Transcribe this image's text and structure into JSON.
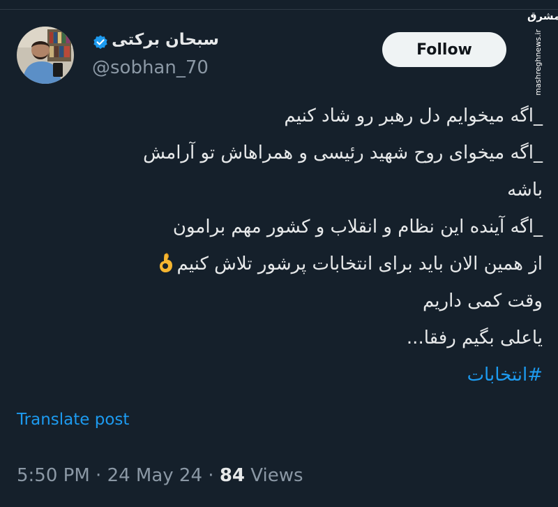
{
  "watermark": {
    "logo": "مشرق",
    "url": "mashreghnews.ir"
  },
  "author": {
    "display_name": "سبحان برکتی",
    "handle": "@sobhan_70",
    "verified_icon": "verified-badge-icon"
  },
  "follow_button": {
    "label": "Follow"
  },
  "tweet": {
    "lines": [
      "_اگه میخوایم دل رهبر رو شاد کنیم",
      "_اگه میخوای روح شهید رئیسی و همراهاش تو آرامش",
      "باشه",
      "_اگه آینده این نظام و انقلاب و کشور مهم برامون",
      "از همین الان باید برای انتخابات پرشور تلاش کنیم",
      "وقت کمی داریم",
      "یاعلی بگیم رفقا...",
      "#انتخابات"
    ],
    "emoji": "ok-hand-emoji"
  },
  "translate": {
    "label": "Translate post"
  },
  "meta": {
    "time": "5:50 PM",
    "separator": "·",
    "date": "24 May 24",
    "views_count": "84",
    "views_label": "Views"
  },
  "colors": {
    "background": "#15202b",
    "text": "#e7e9ea",
    "muted": "#8b98a5",
    "link": "#1d9bf0",
    "button": "#eff3f4"
  }
}
